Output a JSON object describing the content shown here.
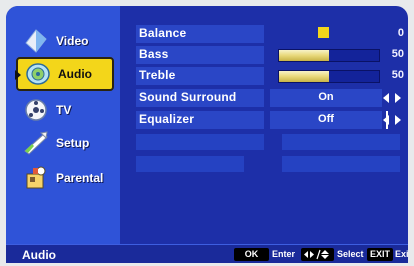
{
  "sidebar": {
    "items": [
      {
        "label": "Video",
        "icon": "video-icon"
      },
      {
        "label": "Audio",
        "icon": "audio-icon",
        "selected": true
      },
      {
        "label": "TV",
        "icon": "tv-icon"
      },
      {
        "label": "Setup",
        "icon": "setup-icon"
      },
      {
        "label": "Parental",
        "icon": "parental-icon"
      }
    ]
  },
  "settings": {
    "balance": {
      "label": "Balance",
      "value": "0",
      "level": 0.5
    },
    "bass": {
      "label": "Bass",
      "value": "50",
      "level": 0.5
    },
    "treble": {
      "label": "Treble",
      "value": "50",
      "level": 0.5
    },
    "sound_surround": {
      "label": "Sound Surround",
      "value": "On"
    },
    "equalizer": {
      "label": "Equalizer",
      "value": "Off"
    }
  },
  "status_bar": {
    "title": "Audio",
    "ok_key": "OK",
    "enter_hint": "Enter",
    "select_hint": "Select",
    "exit_key": "EXIT",
    "exit_hint": "Exit"
  },
  "colors": {
    "background": "#1d2fa8",
    "sidebar": "#2f53d8",
    "selected": "#f3d61a"
  }
}
